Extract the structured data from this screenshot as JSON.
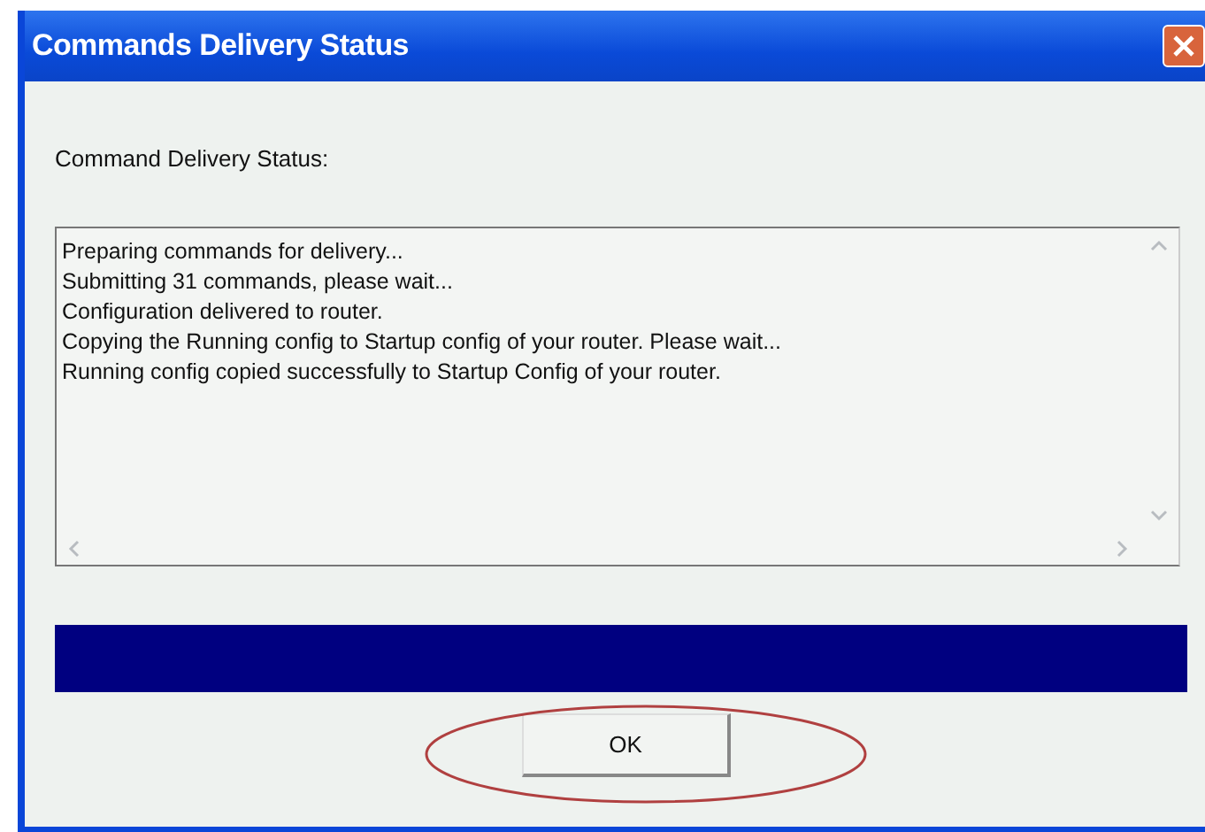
{
  "window": {
    "title": "Commands Delivery Status"
  },
  "status_label": "Command Delivery Status:",
  "log_lines": [
    "Preparing commands for delivery...",
    "Submitting 31 commands, please wait...",
    "Configuration delivered to router.",
    "Copying the Running config to Startup config of your router. Please wait...",
    "Running config copied successfully to Startup Config of your router."
  ],
  "progress": {
    "level": 1
  },
  "buttons": [
    {
      "label": "OK",
      "highlighted": true
    }
  ]
}
